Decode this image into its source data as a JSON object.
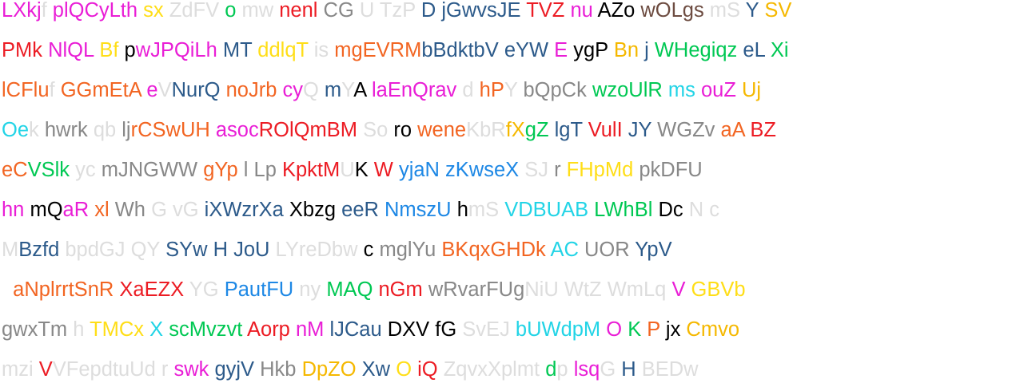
{
  "palette": {
    "R": "#ec1c24",
    "O": "#f26522",
    "Y": "#ffde17",
    "G": "#00c853",
    "C": "#22d4e6",
    "B": "#1e88e5",
    "P": "#e91ed6",
    "N": "#6d4c41",
    "K": "#000000",
    "A": "#888888",
    "L": "#dddddd",
    "T": "#2c5a8a",
    "D": "#f5b800"
  },
  "lines": [
    [
      [
        "LXkj",
        "P"
      ],
      [
        "f ",
        "L"
      ],
      [
        "plQCyLth ",
        "P"
      ],
      [
        "sx ",
        "Y"
      ],
      [
        "ZdFV ",
        "L"
      ],
      [
        "o ",
        "G"
      ],
      [
        "mw ",
        "L"
      ],
      [
        "nenl ",
        "R"
      ],
      [
        "CG ",
        "A"
      ],
      [
        "U TzP ",
        "L"
      ],
      [
        "D ",
        "T"
      ],
      [
        "jGwvsJE ",
        "T"
      ],
      [
        "TVZ ",
        "R"
      ],
      [
        "nu ",
        "P"
      ],
      [
        "AZo ",
        "K"
      ],
      [
        "wOLgs ",
        "N"
      ],
      [
        "mS ",
        "L"
      ],
      [
        "Y ",
        "T"
      ],
      [
        "SV",
        "D"
      ]
    ],
    [
      [
        "PMk ",
        "R"
      ],
      [
        "NlQL ",
        "P"
      ],
      [
        "Bf ",
        "Y"
      ],
      [
        "p",
        "K"
      ],
      [
        "wJPQiLh ",
        "P"
      ],
      [
        "MT ",
        "T"
      ],
      [
        "ddlqT ",
        "Y"
      ],
      [
        "is ",
        "L"
      ],
      [
        "mgEVRM",
        "O"
      ],
      [
        "bBdktbV ",
        "T"
      ],
      [
        "eYW ",
        "T"
      ],
      [
        "E ",
        "P"
      ],
      [
        "ygP ",
        "K"
      ],
      [
        "Bn ",
        "D"
      ],
      [
        "j ",
        "T"
      ],
      [
        "WHegiqz ",
        "G"
      ],
      [
        "eL ",
        "T"
      ],
      [
        "Xi",
        "G"
      ]
    ],
    [
      [
        "lCFlu",
        "O"
      ],
      [
        "f ",
        "L"
      ],
      [
        "GGmEtA ",
        "O"
      ],
      [
        "e",
        "P"
      ],
      [
        "V",
        "L"
      ],
      [
        "NurQ ",
        "T"
      ],
      [
        "noJrb ",
        "O"
      ],
      [
        "cy",
        "P"
      ],
      [
        "Q ",
        "L"
      ],
      [
        "m",
        "T"
      ],
      [
        "Y",
        "L"
      ],
      [
        "A ",
        "K"
      ],
      [
        "laEnQrav ",
        "P"
      ],
      [
        "d ",
        "L"
      ],
      [
        "hP",
        "O"
      ],
      [
        "Y ",
        "L"
      ],
      [
        "bQpCk ",
        "A"
      ],
      [
        "wzoUlR ",
        "G"
      ],
      [
        "ms ",
        "C"
      ],
      [
        "ouZ ",
        "P"
      ],
      [
        "Uj",
        "D"
      ]
    ],
    [
      [
        "Oe",
        "C"
      ],
      [
        "k ",
        "L"
      ],
      [
        "hwrk ",
        "A"
      ],
      [
        "qb ",
        "L"
      ],
      [
        "lj",
        "A"
      ],
      [
        "rCSwUH ",
        "O"
      ],
      [
        "asoc",
        "P"
      ],
      [
        "ROlQmBM ",
        "R"
      ],
      [
        "So ",
        "L"
      ],
      [
        "ro ",
        "K"
      ],
      [
        "wene",
        "O"
      ],
      [
        "KbR",
        "L"
      ],
      [
        "fX",
        "D"
      ],
      [
        "gZ ",
        "G"
      ],
      [
        "lgT ",
        "T"
      ],
      [
        "VulI ",
        "R"
      ],
      [
        "JY ",
        "T"
      ],
      [
        "WGZv ",
        "A"
      ],
      [
        "aA ",
        "O"
      ],
      [
        "BZ",
        "R"
      ]
    ],
    [
      [
        "eC",
        "O"
      ],
      [
        "VSlk ",
        "G"
      ],
      [
        "yc ",
        "L"
      ],
      [
        "mJNGWW ",
        "A"
      ],
      [
        "gYp ",
        "O"
      ],
      [
        "l Lp ",
        "A"
      ],
      [
        "KpktM",
        "R"
      ],
      [
        "U",
        "L"
      ],
      [
        "K ",
        "K"
      ],
      [
        "W ",
        "R"
      ],
      [
        "yjaN ",
        "B"
      ],
      [
        "zKwseX ",
        "B"
      ],
      [
        "SJ ",
        "L"
      ],
      [
        "r ",
        "A"
      ],
      [
        "FHpMd ",
        "Y"
      ],
      [
        "pkDFU",
        "A"
      ]
    ],
    [
      [
        "hn ",
        "P"
      ],
      [
        "mQ",
        "K"
      ],
      [
        "aR ",
        "P"
      ],
      [
        "xl ",
        "O"
      ],
      [
        "Wh ",
        "A"
      ],
      [
        "G ",
        "L"
      ],
      [
        "vG ",
        "L"
      ],
      [
        "iXWzrXa ",
        "T"
      ],
      [
        "Xbzg ",
        "K"
      ],
      [
        "eeR ",
        "T"
      ],
      [
        "NmszU ",
        "B"
      ],
      [
        "h",
        "K"
      ],
      [
        "mS ",
        "L"
      ],
      [
        "VDBUAB ",
        "C"
      ],
      [
        "LWhBl ",
        "G"
      ],
      [
        "Dc ",
        "K"
      ],
      [
        "N c",
        "L"
      ]
    ],
    [
      [
        "M",
        "L"
      ],
      [
        "Bzfd ",
        "T"
      ],
      [
        "bpdGJ ",
        "L"
      ],
      [
        "QY ",
        "L"
      ],
      [
        "SYw ",
        "T"
      ],
      [
        "H ",
        "T"
      ],
      [
        "JoU ",
        "T"
      ],
      [
        "LYreDbw ",
        "L"
      ],
      [
        "c ",
        "K"
      ],
      [
        "mglYu ",
        "A"
      ],
      [
        "BKqxGHDk ",
        "O"
      ],
      [
        "AC ",
        "C"
      ],
      [
        "UOR ",
        "A"
      ],
      [
        "YpV",
        "T"
      ]
    ],
    [
      [
        "  aNplrrtSnR ",
        "O"
      ],
      [
        "XaEZX ",
        "R"
      ],
      [
        "YG ",
        "L"
      ],
      [
        "PautFU ",
        "B"
      ],
      [
        "ny ",
        "L"
      ],
      [
        "MAQ ",
        "G"
      ],
      [
        "nGm ",
        "R"
      ],
      [
        "wRvarFUg",
        "A"
      ],
      [
        "NiU ",
        "L"
      ],
      [
        "WtZ ",
        "L"
      ],
      [
        "WmLq ",
        "L"
      ],
      [
        "V ",
        "P"
      ],
      [
        "GBVb",
        "Y"
      ]
    ],
    [
      [
        "gwxTm ",
        "A"
      ],
      [
        "h ",
        "L"
      ],
      [
        "TMCx ",
        "Y"
      ],
      [
        "X ",
        "C"
      ],
      [
        "scMvzvt ",
        "G"
      ],
      [
        "Aorp ",
        "R"
      ],
      [
        "nM ",
        "P"
      ],
      [
        "lJCau ",
        "T"
      ],
      [
        "DXV ",
        "K"
      ],
      [
        "fG ",
        "K"
      ],
      [
        "SvEJ ",
        "L"
      ],
      [
        "bUWdpM ",
        "C"
      ],
      [
        "O ",
        "P"
      ],
      [
        "K ",
        "G"
      ],
      [
        "P ",
        "O"
      ],
      [
        "jx ",
        "K"
      ],
      [
        "Cmvo",
        "D"
      ]
    ],
    [
      [
        "mzi ",
        "L"
      ],
      [
        "V",
        "R"
      ],
      [
        "VFepdtuUd ",
        "L"
      ],
      [
        "r ",
        "L"
      ],
      [
        "swk ",
        "P"
      ],
      [
        "gyjV ",
        "T"
      ],
      [
        "Hkb ",
        "A"
      ],
      [
        "DpZO ",
        "D"
      ],
      [
        "Xw ",
        "T"
      ],
      [
        "O ",
        "Y"
      ],
      [
        "iQ ",
        "R"
      ],
      [
        "ZqvxXplmt ",
        "L"
      ],
      [
        "d",
        "G"
      ],
      [
        "p ",
        "L"
      ],
      [
        "lsq",
        "P"
      ],
      [
        "G ",
        "L"
      ],
      [
        "H ",
        "T"
      ],
      [
        "BEDw",
        "L"
      ]
    ]
  ],
  "segment_colors": [
    [
      "R",
      "O",
      "P",
      "Y",
      "L",
      "G",
      "L",
      "R",
      "A",
      "L",
      "T",
      "T",
      "R",
      "P",
      "K",
      "N",
      "L",
      "T",
      "D"
    ],
    [
      "R",
      "P",
      "Y",
      "K",
      "P",
      "T",
      "Y",
      "L",
      "O",
      "T",
      "T",
      "P",
      "K",
      "D",
      "T",
      "G",
      "T",
      "G"
    ],
    [
      "O",
      "L",
      "O",
      "P",
      "L",
      "T",
      "O",
      "P",
      "L",
      "T",
      "L",
      "K",
      "P",
      "L",
      "O",
      "L",
      "A",
      "G",
      "C",
      "P",
      "D"
    ],
    [
      "C",
      "L",
      "A",
      "L",
      "A",
      "O",
      "P",
      "R",
      "L",
      "K",
      "O",
      "L",
      "D",
      "G",
      "T",
      "R",
      "T",
      "A",
      "O",
      "R"
    ],
    [
      "O",
      "L",
      "G",
      "L",
      "A",
      "O",
      "A",
      "R",
      "L",
      "K",
      "R",
      "B",
      "B",
      "L",
      "A",
      "Y",
      "A"
    ],
    [
      "P",
      "K",
      "P",
      "O",
      "A",
      "L",
      "L",
      "T",
      "K",
      "T",
      "B",
      "K",
      "L",
      "C",
      "G",
      "K",
      "L"
    ],
    [
      "L",
      "T",
      "L",
      "L",
      "T",
      "T",
      "T",
      "L",
      "K",
      "A",
      "O",
      "C",
      "A",
      "T"
    ],
    [
      "O",
      "R",
      "L",
      "B",
      "L",
      "G",
      "R",
      "A",
      "L",
      "L",
      "L",
      "P",
      "Y"
    ],
    [
      "A",
      "L",
      "Y",
      "C",
      "G",
      "R",
      "P",
      "T",
      "K",
      "K",
      "L",
      "C",
      "P",
      "G",
      "O",
      "K",
      "D"
    ],
    [
      "L",
      "R",
      "L",
      "L",
      "P",
      "T",
      "A",
      "D",
      "T",
      "Y",
      "R",
      "L",
      "G",
      "L",
      "P",
      "L",
      "T",
      "L"
    ]
  ]
}
